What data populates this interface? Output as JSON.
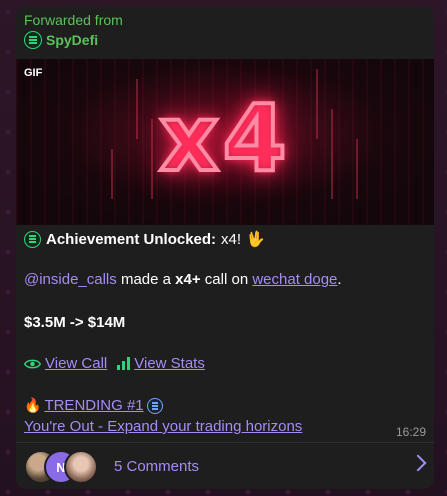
{
  "forward": {
    "label": "Forwarded from",
    "channel": "SpyDefi"
  },
  "media": {
    "badge": "GIF",
    "text": "x4"
  },
  "message": {
    "achievement_label": "Achievement Unlocked:",
    "achievement_value": "x4!",
    "achievement_emoji": "🖖",
    "mention": "@inside_calls",
    "call_text_1": "made a",
    "call_bold": "x4+",
    "call_text_2": "call on",
    "token_link": "wechat doge",
    "call_end": ".",
    "mcap": "$3.5M -> $14M",
    "view_call": "View Call",
    "view_stats": "View Stats",
    "trend_emoji": "🔥",
    "trending": "TRENDING #1",
    "promo": "You're Out - Expand your trading horizons",
    "time": "16:29"
  },
  "comments": {
    "avatar_letter": "N",
    "label": "5 Comments"
  },
  "colors": {
    "accent": "#a68cf5",
    "green": "#5bc25b",
    "neon": "#ff2e5a"
  }
}
